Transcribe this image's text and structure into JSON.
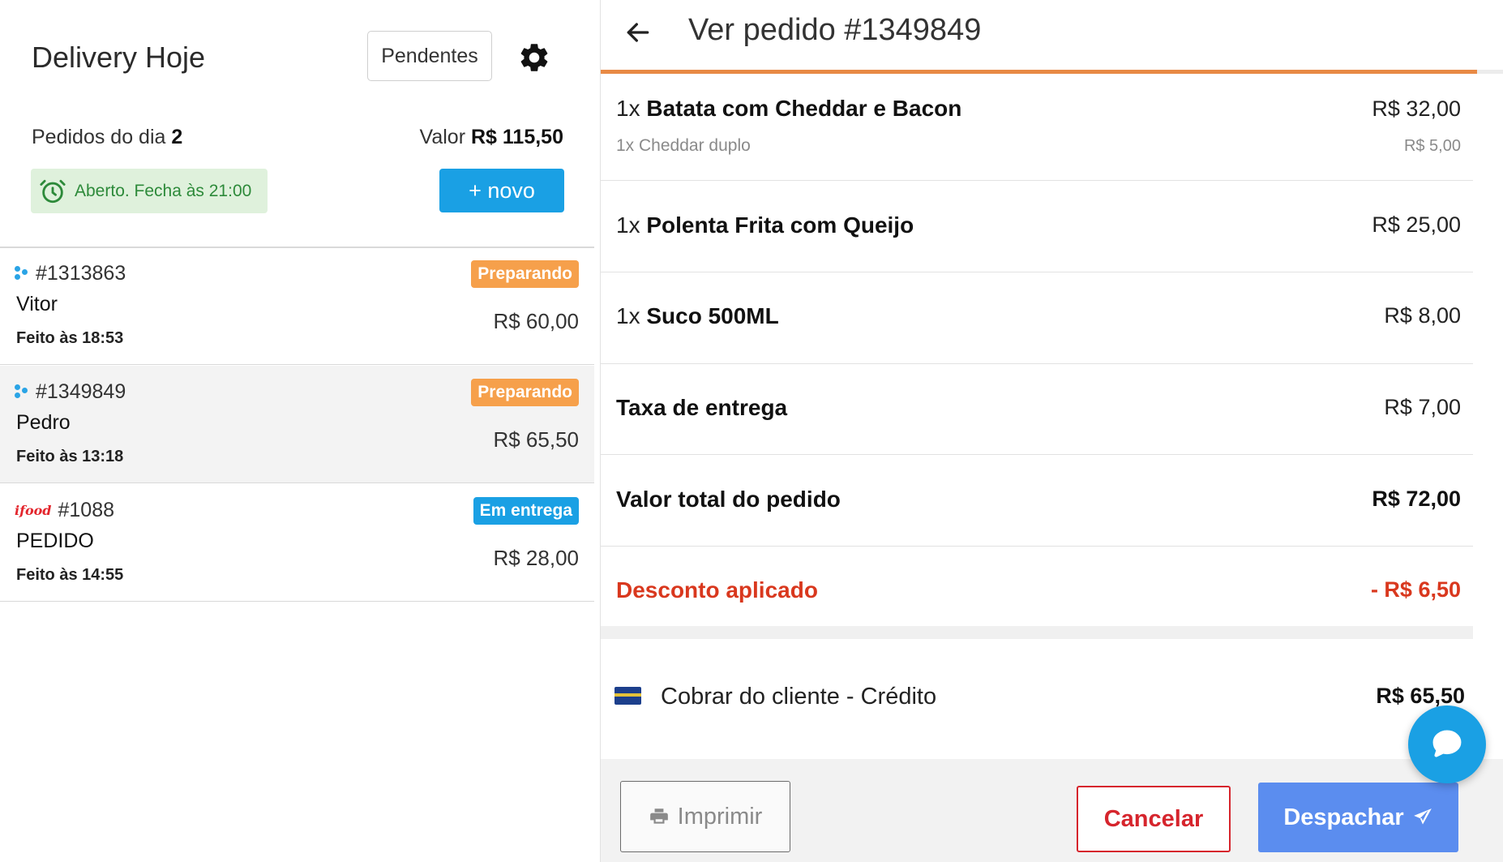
{
  "left": {
    "title": "Delivery Hoje",
    "pending_label": "Pendentes",
    "orders_of_day_label": "Pedidos do dia",
    "orders_of_day_count": "2",
    "value_label": "Valor",
    "value_amount": "R$ 115,50",
    "open_status": "Aberto. Fecha às 21:00",
    "new_button": "+ novo"
  },
  "orders": [
    {
      "number": "#1313863",
      "customer": "Vitor",
      "time": "Feito às 18:53",
      "amount": "R$ 60,00",
      "status": "Preparando",
      "status_color": "#f6a04b",
      "source_icon": "dots-icon"
    },
    {
      "number": "#1349849",
      "customer": "Pedro",
      "time": "Feito às 13:18",
      "amount": "R$ 65,50",
      "status": "Preparando",
      "status_color": "#f6a04b",
      "source_icon": "dots-icon"
    },
    {
      "number": "#1088",
      "customer": "PEDIDO",
      "time": "Feito às 14:55",
      "amount": "R$ 28,00",
      "status": "Em entrega",
      "status_color": "#1aa0e4",
      "source_icon": "ifood-logo",
      "source_logo_text": "ifood"
    }
  ],
  "detail": {
    "title": "Ver pedido #1349849",
    "items": [
      {
        "qty": "1x",
        "name": "Batata com Cheddar e Bacon",
        "price": "R$ 32,00",
        "sub": "1x Cheddar duplo",
        "sub_price": "R$ 5,00"
      },
      {
        "qty": "1x",
        "name": "Polenta Frita com Queijo",
        "price": "R$ 25,00"
      },
      {
        "qty": "1x",
        "name": "Suco 500ML",
        "price": "R$ 8,00"
      }
    ],
    "delivery_fee_label": "Taxa de entrega",
    "delivery_fee": "R$ 7,00",
    "total_label": "Valor total do pedido",
    "total": "R$ 72,00",
    "discount_label": "Desconto aplicado",
    "discount": "- R$ 6,50",
    "payment_label": "Cobrar do cliente - Crédito",
    "payment_amount": "R$ 65,50",
    "print_button": "Imprimir",
    "cancel_button": "Cancelar",
    "dispatch_button": "Despachar"
  },
  "colors": {
    "accent_blue": "#1aa0e4",
    "accent_orange": "#e88a45",
    "discount_red": "#d9381e",
    "dispatch_blue": "#5b8def",
    "open_green": "#2d8a3a"
  }
}
